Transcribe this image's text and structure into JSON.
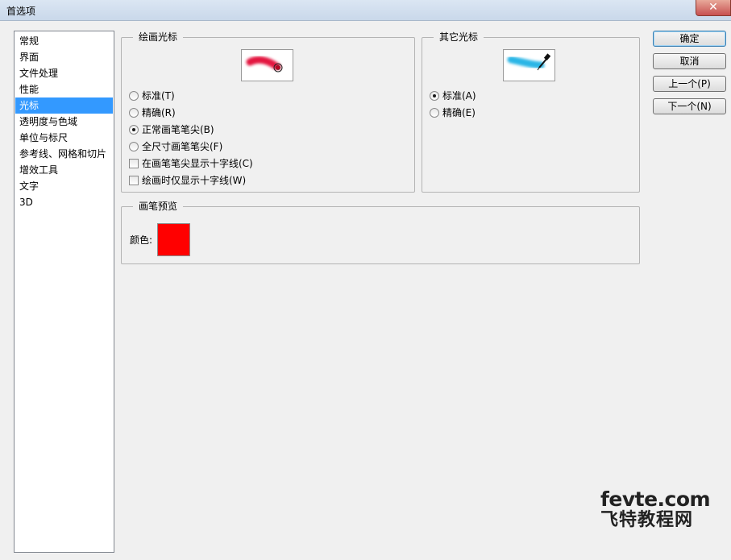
{
  "window": {
    "title": "首选项",
    "close_glyph": "✕"
  },
  "sidebar": {
    "items": [
      {
        "label": "常规"
      },
      {
        "label": "界面"
      },
      {
        "label": "文件处理"
      },
      {
        "label": "性能"
      },
      {
        "label": "光标",
        "selected": true
      },
      {
        "label": "透明度与色域"
      },
      {
        "label": "单位与标尺"
      },
      {
        "label": "参考线、网格和切片"
      },
      {
        "label": "增效工具"
      },
      {
        "label": "文字"
      },
      {
        "label": "3D"
      }
    ]
  },
  "painting_cursors": {
    "legend": "绘画光标",
    "preview_icon": "red-brush-stroke-icon",
    "options": [
      {
        "type": "radio",
        "label": "标准(T)",
        "checked": false
      },
      {
        "type": "radio",
        "label": "精确(R)",
        "checked": false
      },
      {
        "type": "radio",
        "label": "正常画笔笔尖(B)",
        "checked": true
      },
      {
        "type": "radio",
        "label": "全尺寸画笔笔尖(F)",
        "checked": false
      },
      {
        "type": "checkbox",
        "label": "在画笔笔尖显示十字线(C)",
        "checked": false
      },
      {
        "type": "checkbox",
        "label": "绘画时仅显示十字线(W)",
        "checked": false
      }
    ]
  },
  "other_cursors": {
    "legend": "其它光标",
    "preview_icon": "eyedropper-stroke-icon",
    "options": [
      {
        "type": "radio",
        "label": "标准(A)",
        "checked": true
      },
      {
        "type": "radio",
        "label": "精确(E)",
        "checked": false
      }
    ]
  },
  "brush_preview": {
    "legend": "画笔预览",
    "color_label": "颜色:",
    "color": "#ff0000"
  },
  "buttons": {
    "ok": "确定",
    "cancel": "取消",
    "prev": "上一个(P)",
    "next": "下一个(N)"
  },
  "watermark": {
    "en": "fevte.com",
    "cn": "飞特教程网"
  },
  "colors": {
    "selection": "#3399ff",
    "brush": "#ff0000",
    "accent_cyan": "#29b6e6",
    "accent_red": "#e3173f"
  }
}
